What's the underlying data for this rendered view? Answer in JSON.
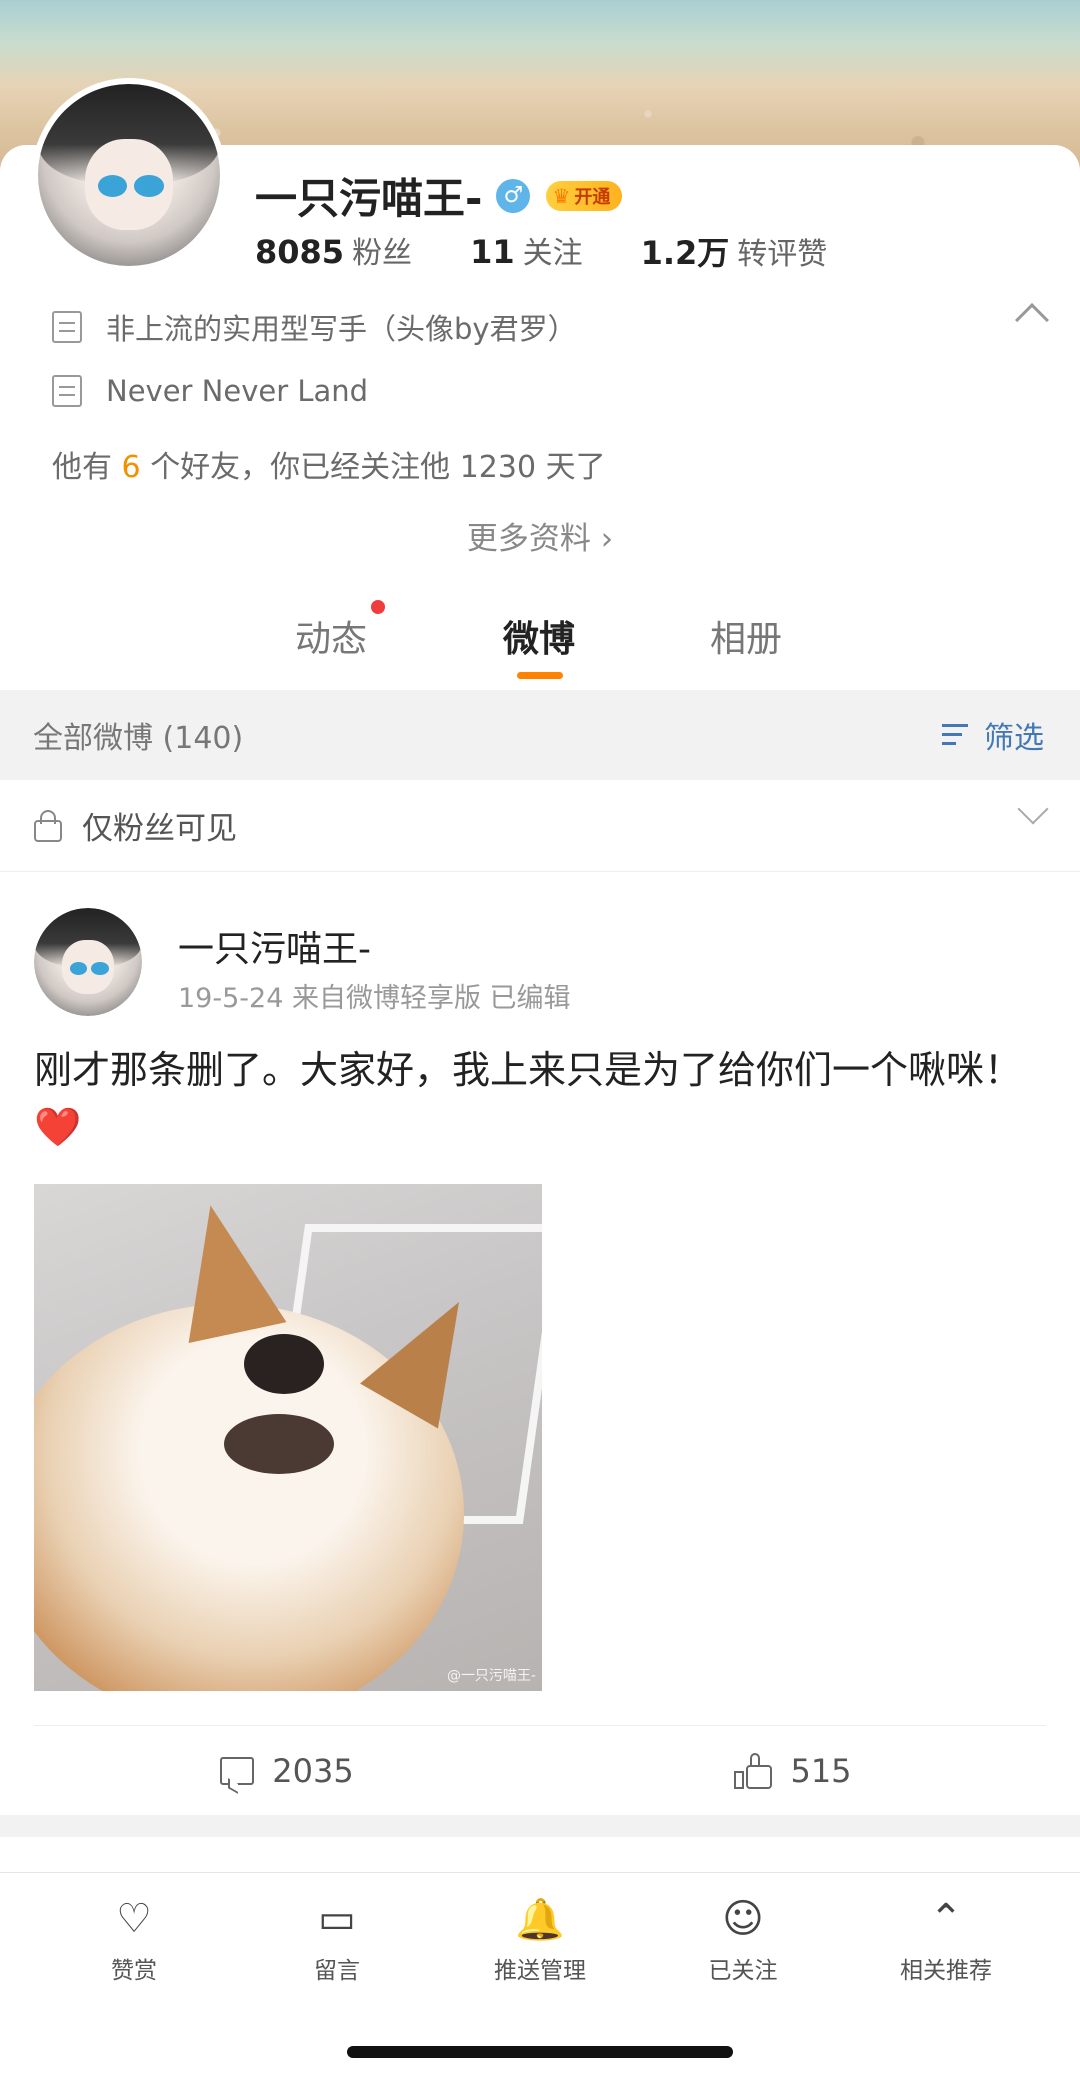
{
  "profile": {
    "name": "一只污喵王-",
    "gender_symbol": "♂",
    "vip_label": "开通",
    "stats": [
      {
        "value": "8085",
        "label": "粉丝"
      },
      {
        "value": "11",
        "label": "关注"
      },
      {
        "value": "1.2万",
        "label": "转评赞"
      }
    ],
    "bio": "非上流的实用型写手（头像by君罗）",
    "location": "Never Never Land",
    "friends_prefix": "他有",
    "friends_count": "6",
    "friends_suffix": "个好友，你已经关注他 1230 天了",
    "more_label": "更多资料 ›"
  },
  "tabs": [
    "动态",
    "微博",
    "相册"
  ],
  "feed": {
    "title": "全部微博 (140)",
    "filter_label": "筛选",
    "visibility_label": "仅粉丝可见"
  },
  "post": {
    "author": "一只污喵王-",
    "meta": "19-5-24  来自微博轻享版  已编辑",
    "text": "刚才那条删了。大家好，我上来只是为了给你们一个啾咪！",
    "emoji": "❤️",
    "watermark": "@一只污喵王-",
    "comments": "2035",
    "likes": "515"
  },
  "bottom_nav": [
    {
      "icon": "reward-icon",
      "label": "赞赏"
    },
    {
      "icon": "message-icon",
      "label": "留言"
    },
    {
      "icon": "bell-plus-icon",
      "label": "推送管理"
    },
    {
      "icon": "user-check-icon",
      "label": "已关注"
    },
    {
      "icon": "chevron-up-circle-icon",
      "label": "相关推荐"
    }
  ]
}
